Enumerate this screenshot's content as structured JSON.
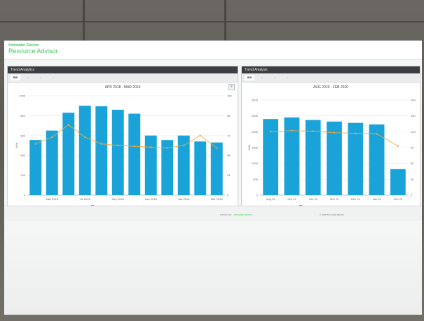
{
  "app": {
    "brand": "Schneider Electric",
    "title": "Resource Advisor"
  },
  "left_panel": {
    "header": "Trend Analytics",
    "tabs": [
      "Bill",
      "",
      "",
      ""
    ],
    "chart_title": "APR 2018 - MAR 2019",
    "menu_icon": "hamburger-menu-icon"
  },
  "right_panel": {
    "header": "Trend Analysis",
    "tabs": [
      "Bill",
      "",
      "",
      ""
    ],
    "chart_title": "AUG 2019 - FEB 2020",
    "menu_icon": "hamburger-menu-icon"
  },
  "footer": {
    "powered_by": "Solutions by",
    "brand": "Schneider Electric",
    "copyright": "© 2018 Schneider Electric"
  },
  "chart_data": [
    {
      "type": "bar",
      "title": "APR 2018 - MAR 2019",
      "categories": [
        "Apr 2018",
        "May 2018",
        "Jun 2018",
        "Jul 2018",
        "Aug 2018",
        "Sep 2018",
        "Oct 2018",
        "Nov 2018",
        "Dec 2018",
        "Jan 2019",
        "Feb 2019",
        "Mar 2019"
      ],
      "x_tick_labels": [
        "May 2018",
        "Jul 2018",
        "Sep 2018",
        "Nov 2018",
        "Jan 2019",
        "Mar 2019"
      ],
      "series": [
        {
          "name": "Potential Bill Savings kWh",
          "type": "bar",
          "axis": "left",
          "color": "#1aa3d9",
          "values": [
            555,
            650,
            830,
            900,
            895,
            860,
            820,
            600,
            555,
            600,
            540,
            530
          ]
        },
        {
          "name": "Potential Bill Savings USD",
          "type": "line",
          "axis": "right",
          "color": "#f2a83b",
          "values": [
            62,
            70,
            85,
            70,
            62,
            60,
            59,
            58,
            57,
            60,
            72,
            57
          ]
        }
      ],
      "ylim_left": [
        0,
        1000
      ],
      "yticks_left": [
        "0",
        "200",
        "400",
        "600",
        "800",
        "1000"
      ],
      "ylabel_left": "kWh",
      "ylim_right": [
        0,
        120
      ],
      "yticks_right": [
        "0",
        "24",
        "48",
        "72",
        "96",
        "120"
      ],
      "legend_position": "bottom"
    },
    {
      "type": "bar",
      "title": "AUG 2019 - FEB 2020",
      "categories": [
        "Aug 2019",
        "Sep 2019",
        "Oct 2019",
        "Nov 2019",
        "Dec 2019",
        "Jan 2020",
        "Feb 2020"
      ],
      "x_tick_labels": [
        "Aug 19",
        "Sep 19",
        "Oct 19",
        "Nov 19",
        "Dec 19",
        "Jan 20",
        "Feb 20"
      ],
      "series": [
        {
          "name": "Potential Bill Savings kWh",
          "type": "bar",
          "axis": "left",
          "color": "#1aa3d9",
          "values": [
            2400,
            2450,
            2370,
            2320,
            2280,
            2230,
            820
          ]
        },
        {
          "name": "Potential Bill Savings USD",
          "type": "line",
          "axis": "right",
          "color": "#f2a83b",
          "values": [
            120,
            122,
            121,
            118,
            117,
            116,
            93
          ]
        }
      ],
      "ylim_left": [
        0,
        3000
      ],
      "yticks_left": [
        "0",
        "500",
        "1000",
        "1500",
        "2000",
        "2500",
        "3000"
      ],
      "ylabel_left": "kWh",
      "ylim_right": [
        0,
        180
      ],
      "yticks_right": [
        "0",
        "30",
        "60",
        "90",
        "120",
        "150",
        "180"
      ],
      "legend_position": "bottom"
    }
  ]
}
